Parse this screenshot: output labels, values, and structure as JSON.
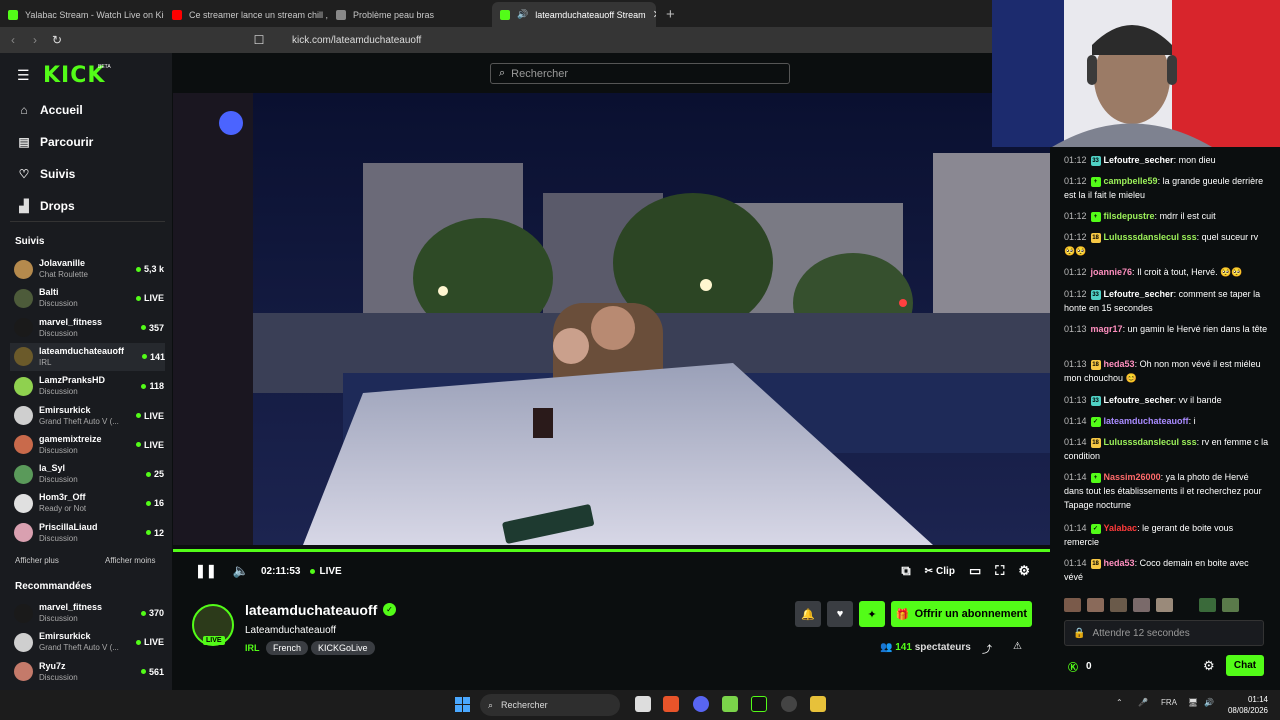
{
  "browser": {
    "tabs": [
      {
        "title": "Yalabac Stream - Watch Live on Kick",
        "color": "#53fc18"
      },
      {
        "title": "Ce streamer lance un stream chill , pu",
        "color": "#ff0000"
      },
      {
        "title": "Problème peau bras",
        "color": "#dddddd"
      },
      {
        "title": "lateamduchateauoff Stream",
        "color": "#53fc18",
        "active": true
      }
    ],
    "url": "kick.com/lateamduchateauoff"
  },
  "app": {
    "logo": "KICK",
    "beta": "BETA",
    "search_placeholder": "Rechercher",
    "nav": [
      {
        "label": "Accueil",
        "icon": "home-icon"
      },
      {
        "label": "Parcourir",
        "icon": "browse-icon"
      },
      {
        "label": "Suivis",
        "icon": "heart-icon"
      },
      {
        "label": "Drops",
        "icon": "drops-icon"
      }
    ],
    "following_title": "Suivis",
    "following": [
      {
        "name": "Jolavanille",
        "category": "Chat Roulette",
        "viewers": "5,3 k",
        "avatar": "#b58a4d"
      },
      {
        "name": "Balti",
        "category": "Discussion",
        "viewers": "LIVE",
        "avatar": "#4d5b3a"
      },
      {
        "name": "marvel_fitness",
        "category": "Discussion",
        "viewers": "357",
        "avatar": "#1a1a1a"
      },
      {
        "name": "lateamduchateauoff",
        "category": "IRL",
        "viewers": "141",
        "avatar": "#6b5a2a",
        "selected": true
      },
      {
        "name": "LamzPranksHD",
        "category": "Discussion",
        "viewers": "118",
        "avatar": "#8fd14f"
      },
      {
        "name": "Emirsurkick",
        "category": "Grand Theft Auto V (...",
        "viewers": "LIVE",
        "avatar": "#cfcfcf"
      },
      {
        "name": "gamemixtreize",
        "category": "Discussion",
        "viewers": "LIVE",
        "avatar": "#c96a4b"
      },
      {
        "name": "la_Syl",
        "category": "Discussion",
        "viewers": "25",
        "avatar": "#5a9a5a"
      },
      {
        "name": "Hom3r_Off",
        "category": "Ready or Not",
        "viewers": "16",
        "avatar": "#e0e0e0"
      },
      {
        "name": "PriscillaLiaud",
        "category": "Discussion",
        "viewers": "12",
        "avatar": "#d9a0b0"
      }
    ],
    "show_more": "Afficher plus",
    "show_less": "Afficher moins",
    "recommended_title": "Recommandées",
    "recommended": [
      {
        "name": "marvel_fitness",
        "category": "Discussion",
        "viewers": "370",
        "avatar": "#1a1a1a"
      },
      {
        "name": "Emirsurkick",
        "category": "Grand Theft Auto V (...",
        "viewers": "LIVE",
        "avatar": "#cfcfcf"
      },
      {
        "name": "Ryu7z",
        "category": "Discussion",
        "viewers": "561",
        "avatar": "#c47a6a"
      }
    ]
  },
  "player": {
    "time": "02:11:53",
    "live": "LIVE",
    "clip": "Clip"
  },
  "stream": {
    "name": "lateamduchateauoff",
    "title": "Lateamduchateauoff",
    "category": "IRL",
    "tags": [
      "French",
      "KICKGoLive"
    ],
    "live_badge": "LIVE",
    "subscribe": "Offrir un abonnement",
    "viewers_count": "141",
    "viewers_label": "spectateurs"
  },
  "chat": {
    "messages": [
      {
        "time": "01:12",
        "badge": "#4fd1c5",
        "badge_text": "33",
        "user": "Lefoutre_secher",
        "color": "#ffffff",
        "text": "mon dieu"
      },
      {
        "time": "01:12",
        "badge": "#53fc18",
        "badge_text": "+",
        "user": "campbelle59",
        "color": "#9cf05a",
        "text": "la grande gueule derrière est la il fait le mieleu"
      },
      {
        "time": "01:12",
        "badge": "#53fc18",
        "badge_text": "+",
        "user": "filsdepustre",
        "color": "#9cf05a",
        "text": "mdrr il est cuit"
      },
      {
        "time": "01:12",
        "badge": "#f6c744",
        "badge_text": "18",
        "user": "Lulusssdanslecul sss",
        "color": "#9cf05a",
        "text": "quel suceur rv 🥺🥺"
      },
      {
        "time": "01:12",
        "badge": "",
        "badge_text": "",
        "user": "joannie76",
        "color": "#ff8fbf",
        "text": "Il croit à tout, Hervé. 🥺🥺"
      },
      {
        "time": "01:12",
        "badge": "#4fd1c5",
        "badge_text": "33",
        "user": "Lefoutre_secher",
        "color": "#ffffff",
        "text": "comment se taper la honte en 15 secondes"
      },
      {
        "time": "01:13",
        "badge": "",
        "badge_text": "",
        "user": "magr17",
        "color": "#ff8fbf",
        "text": "un gamin le Hervé rien dans la tête"
      },
      {
        "time": "01:13",
        "badge": "#f6c744",
        "badge_text": "18",
        "user": "heda53",
        "color": "#ff8fbf",
        "text": "Oh non mon vévé il est miéleu mon chouchou 😊"
      },
      {
        "time": "01:13",
        "badge": "#4fd1c5",
        "badge_text": "33",
        "user": "Lefoutre_secher",
        "color": "#ffffff",
        "text": "vv il bande"
      },
      {
        "time": "01:14",
        "badge": "#53fc18",
        "badge_text": "✓",
        "user": "lateamduchateauoff",
        "color": "#a98bff",
        "text": "i"
      },
      {
        "time": "01:14",
        "badge": "#f6c744",
        "badge_text": "18",
        "user": "Lulusssdanslecul sss",
        "color": "#9cf05a",
        "text": "rv en femme c la condition"
      },
      {
        "time": "01:14",
        "badge": "#53fc18",
        "badge_text": "+",
        "user": "Nassim26000",
        "color": "#ff6b6b",
        "text": "ya la photo de Hervé dans tout les établissements il et recherchez pour Tapage nocturne"
      },
      {
        "time": "01:14",
        "badge": "#53fc18",
        "badge_text": "✓",
        "user": "Yalabac",
        "color": "#ff3b3b",
        "text": "le gerant de boite vous remercie"
      },
      {
        "time": "01:14",
        "badge": "#f6c744",
        "badge_text": "18",
        "user": "heda53",
        "color": "#ff8fbf",
        "text": "Coco demain en boite avec vévé"
      }
    ],
    "input_placeholder": "Attendre 12 secondes",
    "points": "0",
    "send": "Chat"
  },
  "taskbar": {
    "search": "Rechercher",
    "lang": "FRA",
    "time": "01:14",
    "date": "08/08/2026"
  }
}
